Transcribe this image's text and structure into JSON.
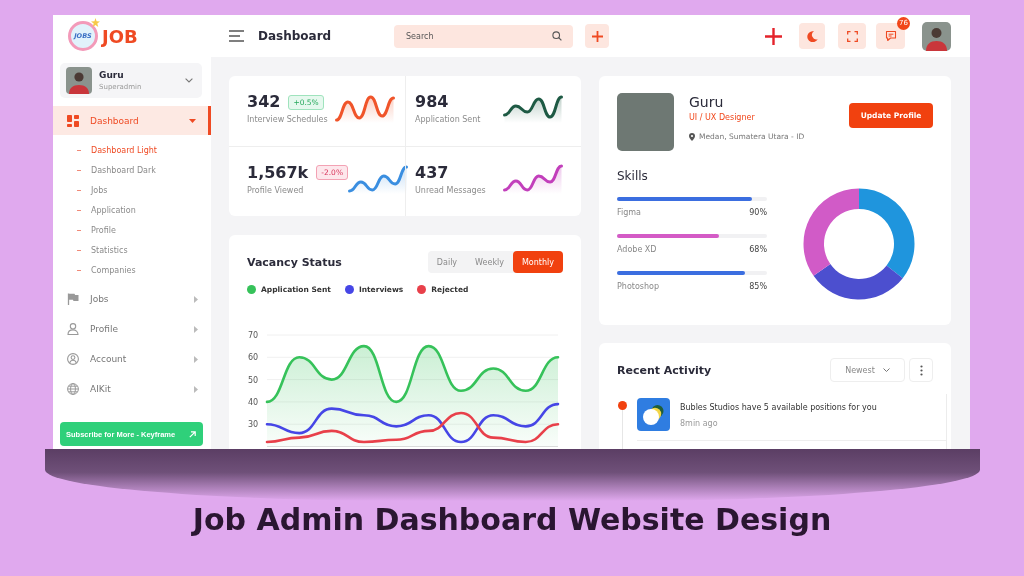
{
  "sidebar": {
    "logo": {
      "mark": "JOBS",
      "name": "JOB"
    },
    "user": {
      "name": "Guru",
      "role": "Superadmin"
    },
    "menu": [
      {
        "label": "Dashboard",
        "selected": true,
        "expanded": true,
        "children": [
          {
            "label": "Dashboard Light",
            "selected": true
          },
          {
            "label": "Dashboard Dark",
            "selected": false
          },
          {
            "label": "Jobs",
            "selected": false
          },
          {
            "label": "Application",
            "selected": false
          },
          {
            "label": "Profile",
            "selected": false
          },
          {
            "label": "Statistics",
            "selected": false
          },
          {
            "label": "Companies",
            "selected": false
          }
        ]
      },
      {
        "label": "Jobs",
        "selected": false,
        "expanded": false
      },
      {
        "label": "Profile",
        "selected": false,
        "expanded": false
      },
      {
        "label": "Account",
        "selected": false,
        "expanded": false
      },
      {
        "label": "AIKit",
        "selected": false,
        "expanded": false
      }
    ],
    "subscribe_button": "Subscribe for More - Keyframe"
  },
  "header": {
    "title": "Dashboard",
    "search": {
      "placeholder": "Search"
    },
    "message_count": "76"
  },
  "stats": [
    {
      "value": "342",
      "badge": {
        "text": "+0.5%",
        "kind": "up"
      },
      "label": "Interview Schedules",
      "color": "#f0542a"
    },
    {
      "value": "984",
      "label": "Application Sent",
      "color": "#1e5a44"
    },
    {
      "value": "1,567k",
      "badge": {
        "text": "-2.0%",
        "kind": "down"
      },
      "label": "Profile Viewed",
      "color": "#3a8ee0"
    },
    {
      "value": "437",
      "label": "Unread Messages",
      "color": "#c23fbb"
    }
  ],
  "vacancy": {
    "title": "Vacancy Status",
    "tabs": [
      {
        "label": "Daily",
        "selected": false
      },
      {
        "label": "Weekly",
        "selected": false
      },
      {
        "label": "Monthly",
        "selected": true
      }
    ],
    "chart_data": {
      "type": "area",
      "stacked": false,
      "ylim": [
        20,
        70
      ],
      "yticks": [
        30,
        40,
        50,
        60,
        70
      ],
      "grid": true,
      "series": [
        {
          "name": "Application Sent",
          "color": "#36c25a",
          "values": [
            40,
            60,
            50,
            65,
            40,
            65,
            45,
            55,
            45,
            60
          ]
        },
        {
          "name": "Interviews",
          "type": "line",
          "color": "#4646e6",
          "values": [
            30,
            26,
            37,
            34,
            29,
            34,
            22,
            34,
            29,
            39
          ]
        },
        {
          "name": "Rejected",
          "type": "line",
          "color": "#e8404a",
          "values": [
            22,
            24,
            27,
            22,
            23,
            27,
            35,
            24,
            22,
            30
          ]
        }
      ]
    }
  },
  "profile": {
    "name": "Guru",
    "role": "UI / UX Designer",
    "location": "Medan, Sumatera Utara - ID",
    "button": "Update Profile",
    "skills_title": "Skills",
    "skills": [
      {
        "name": "Figma",
        "level": 0.9,
        "reading": "90%",
        "color": "#3b6ee0"
      },
      {
        "name": "Adobe XD",
        "level": 0.68,
        "reading": "68%",
        "color": "#d45bc6"
      },
      {
        "name": "Photoshop",
        "level": 0.85,
        "reading": "85%",
        "color": "#3b6ee0"
      }
    ]
  },
  "activity": {
    "title": "Recent Activity",
    "sort": "Newest",
    "items": [
      {
        "text": "Bubles Studios have 5 available positions for you",
        "time": "8min ago"
      }
    ]
  },
  "caption": "Job Admin Dashboard Website Design"
}
